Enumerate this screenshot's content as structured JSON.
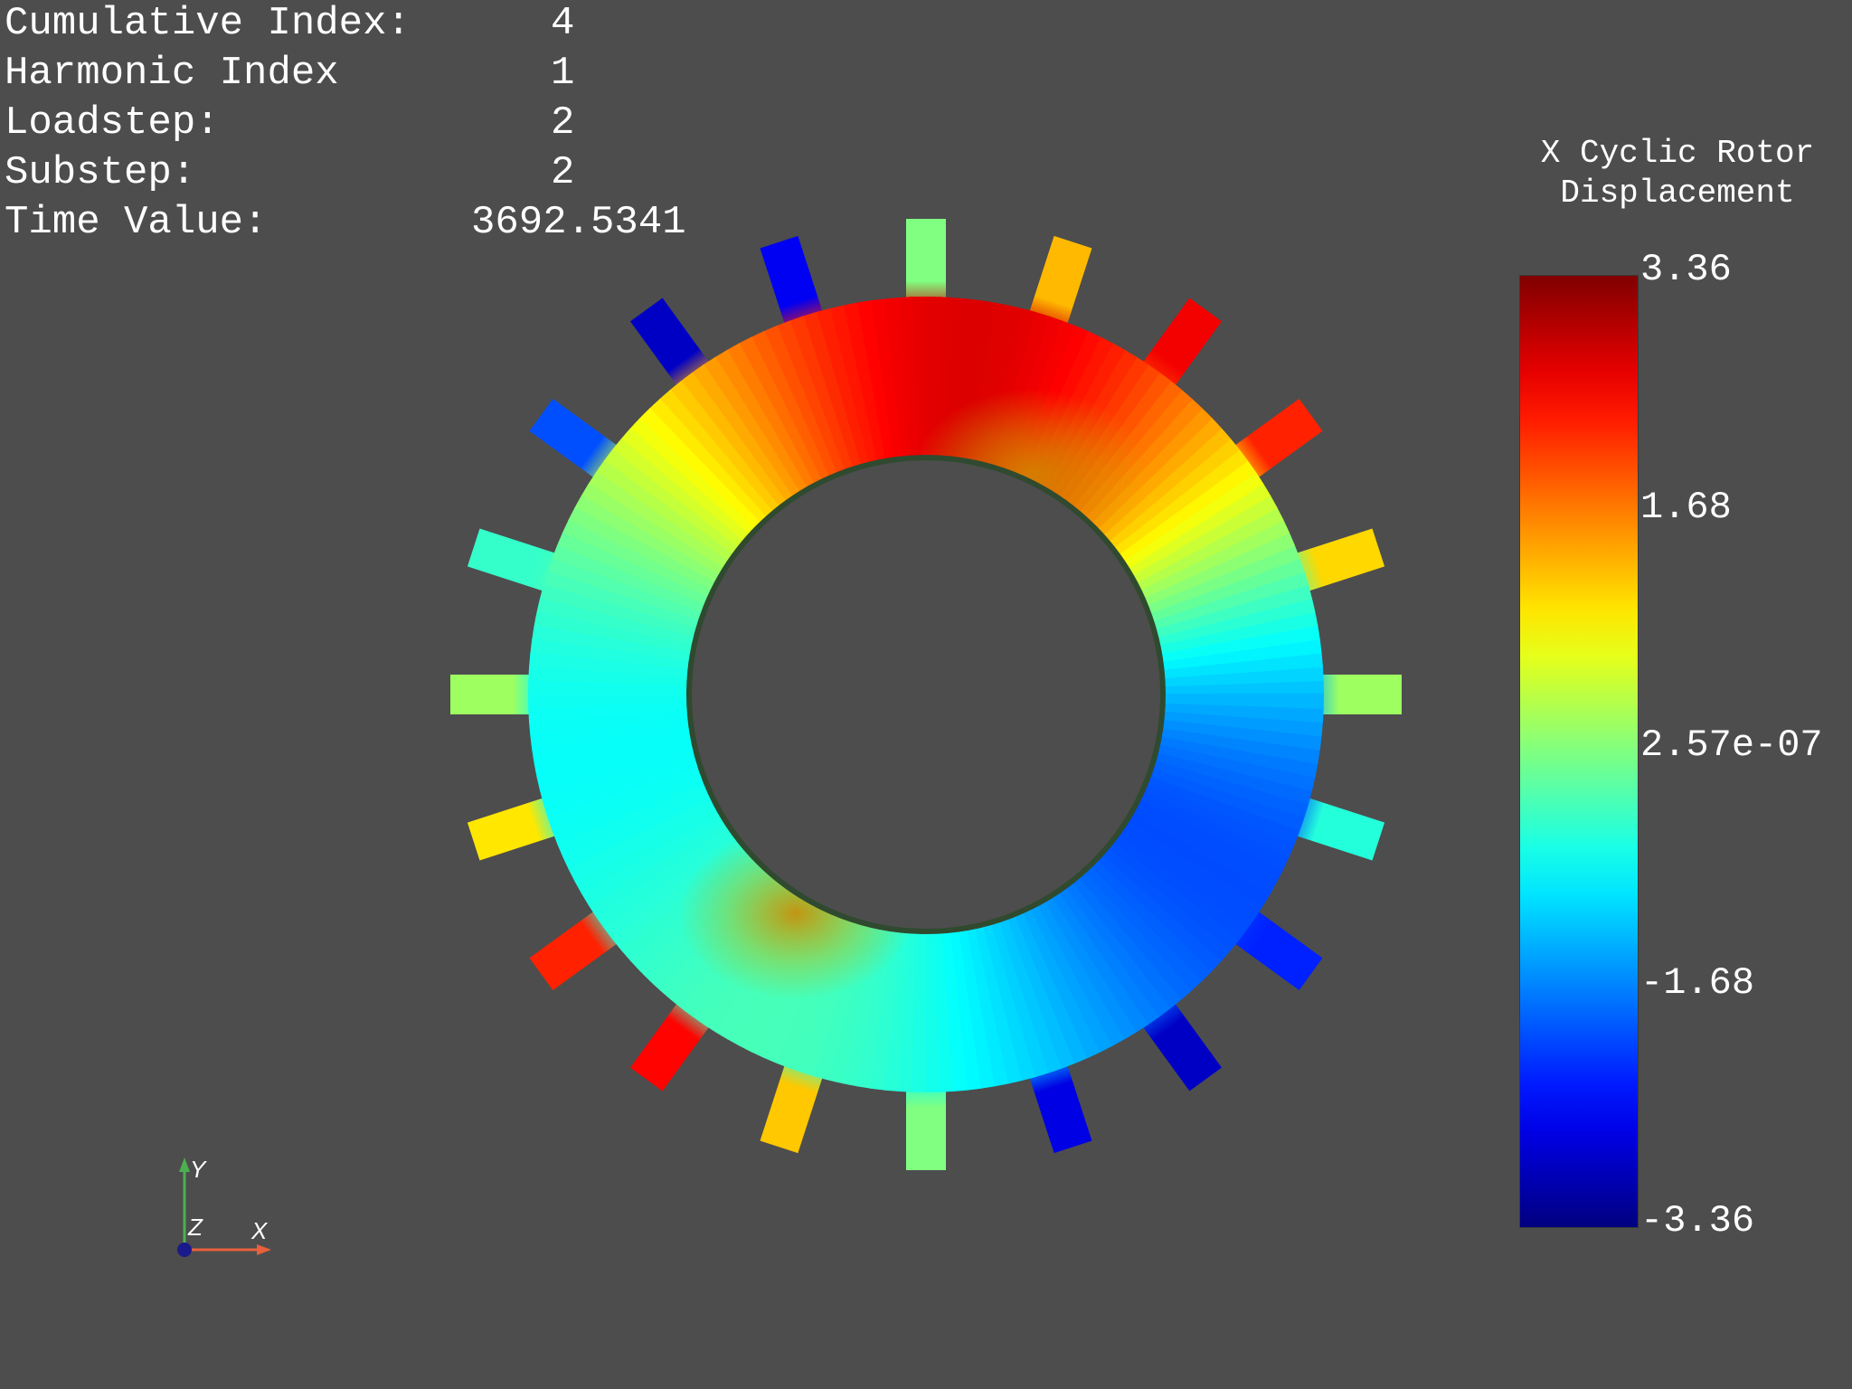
{
  "info": {
    "cumulative_index": {
      "label": "Cumulative Index:",
      "value": "4"
    },
    "harmonic_index": {
      "label": "Harmonic Index",
      "value": "1"
    },
    "loadstep": {
      "label": "Loadstep:",
      "value": "2"
    },
    "substep": {
      "label": "Substep:",
      "value": "2"
    },
    "time_value": {
      "label": "Time Value:",
      "value": "3692.5341"
    }
  },
  "scalar_bar": {
    "title_line1": "X Cyclic Rotor",
    "title_line2": "Displacement",
    "max": 3.36,
    "min": -3.36,
    "colormap": "jet",
    "tick_labels": [
      "3.36",
      "1.68",
      "2.57e-07",
      "-1.68",
      "-3.36"
    ]
  },
  "axes_widget": {
    "y_label": "Y",
    "z_label": "Z",
    "x_label": "X",
    "x_color": "#e8603c",
    "y_color": "#4caf50",
    "z_color": "#1a1a8c"
  },
  "rotor": {
    "blade_count": 20,
    "field_pattern": "nodal diameter 1 with secondary lobes",
    "blade_values": [
      0.0,
      1.3,
      2.6,
      2.3,
      1.1,
      0.2,
      -0.6,
      -2.3,
      -2.9,
      -2.7,
      0.0,
      1.2,
      2.5,
      2.3,
      1.0,
      0.2,
      -0.5,
      -2.0,
      -2.9,
      -2.6
    ]
  },
  "colors": {
    "background": "#4d4d4d",
    "text": "#ffffff"
  }
}
